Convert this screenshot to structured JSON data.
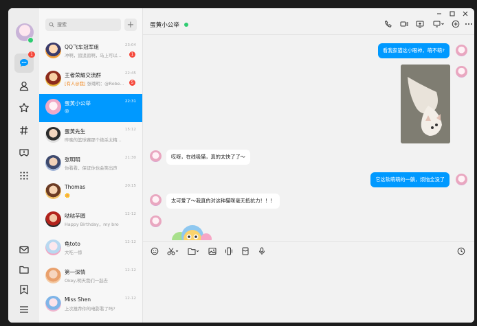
{
  "search": {
    "placeholder": "搜索"
  },
  "rail": {
    "messages_badge": "1"
  },
  "conversations": [
    {
      "name": "QQ飞车冠军组",
      "preview": "冲啊，追追追啊，马上可以...",
      "time": "23:04",
      "badge": "1",
      "tag": ""
    },
    {
      "name": "王者荣耀交流群",
      "preview": "张璐明：@Robe...",
      "time": "22:45",
      "badge": "5",
      "tag": "[有人@我]"
    },
    {
      "name": "蛋黄小公举",
      "preview": "😵",
      "time": "22:31",
      "badge": "",
      "tag": ""
    },
    {
      "name": "蛋黄先生",
      "preview": "昨晚的篮球赛那个绝杀太精...",
      "time": "15:12",
      "badge": "",
      "tag": ""
    },
    {
      "name": "张明明",
      "preview": "你看看，保证你也会笑出声",
      "time": "21:30",
      "badge": "",
      "tag": ""
    },
    {
      "name": "Thomas",
      "preview": "🌼",
      "time": "20:15",
      "badge": "",
      "tag": ""
    },
    {
      "name": "哒哒芋圆",
      "preview": "Happy Birthday，my bro",
      "time": "12-12",
      "badge": "",
      "tag": ""
    },
    {
      "name": "龟toto",
      "preview": "大吃一惊",
      "time": "12-12",
      "badge": "",
      "tag": ""
    },
    {
      "name": "第一深情",
      "preview": "Okey,明天我们一起去",
      "time": "12-12",
      "badge": "",
      "tag": ""
    },
    {
      "name": "Miss Shen",
      "preview": "上次推荐你的电影看了吗?",
      "time": "12-12",
      "badge": "",
      "tag": ""
    }
  ],
  "chat": {
    "title": "蛋黄小公举",
    "messages": [
      {
        "side": "out",
        "text": "看我家猫这小眼神，萌不萌?"
      },
      {
        "side": "in",
        "text": "哎呀，在线吸猫，真的太快了了～"
      },
      {
        "side": "out",
        "text": "它这软萌萌的一躺，烦恼全没了"
      },
      {
        "side": "in",
        "text": "太可爱了～我真的对这种猫咪毫无抵抗力！！！"
      }
    ]
  },
  "colors": {
    "accent": "#0099ff",
    "online": "#2ecc71",
    "badge": "#f5483b"
  }
}
